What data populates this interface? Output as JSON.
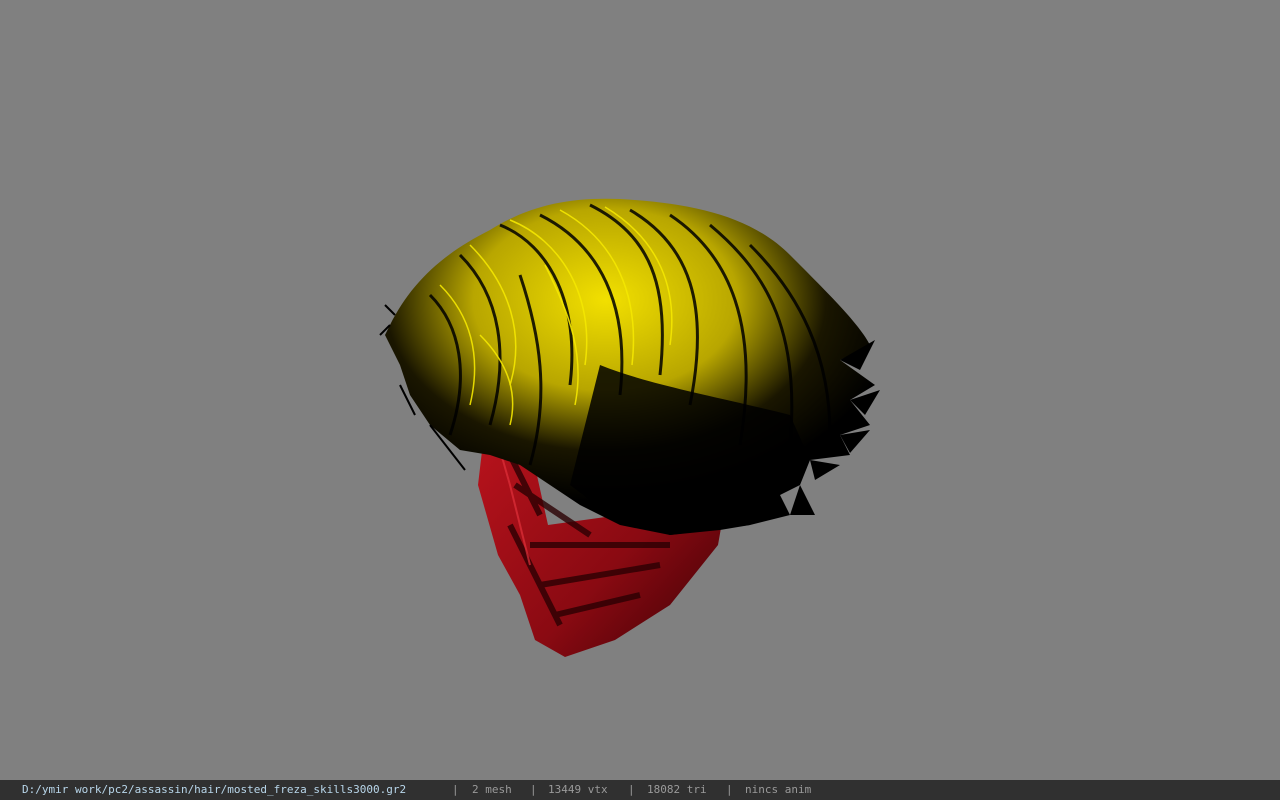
{
  "viewport": {
    "background_color": "#808080",
    "model": {
      "hair_color": "#e6d400",
      "mask_color": "#b0101a"
    }
  },
  "statusbar": {
    "file_path": "D:/ymir work/pc2/assassin/hair/mosted_freza_skills3000.gr2",
    "separator": "|",
    "mesh_count": "2 mesh",
    "vertex_count": "13449 vtx",
    "triangle_count": "18082 tri",
    "animation_info": "nincs anim"
  }
}
